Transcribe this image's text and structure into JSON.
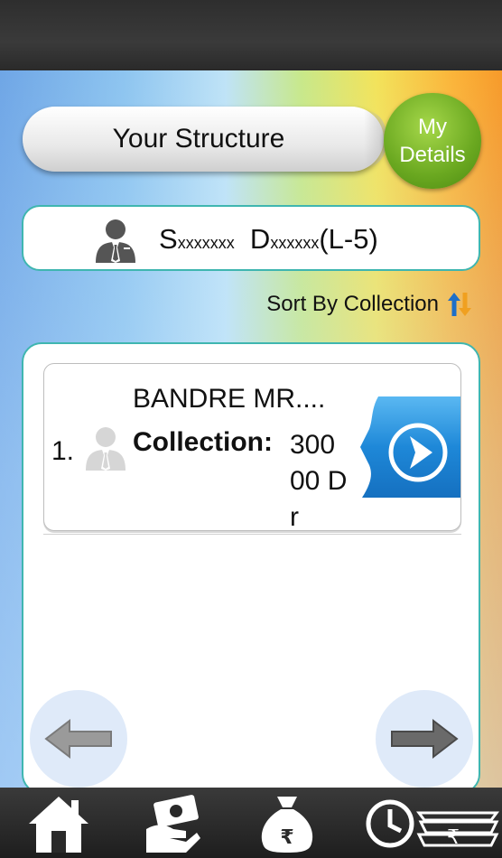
{
  "header": {
    "title": "Your Structure",
    "my_details_line1": "My",
    "my_details_line2": "Details"
  },
  "user": {
    "first_initial": "S",
    "first_rest": "xxxxxxx",
    "last_initial": "D",
    "last_rest": "xxxxxx",
    "level": "(L-5)"
  },
  "sort": {
    "label": "Sort By Collection"
  },
  "list": {
    "items": [
      {
        "index": "1.",
        "name": "BANDRE MR....",
        "collection_label": "Collection:",
        "collection_value": "30000 Dr"
      }
    ]
  },
  "colors": {
    "teal_border": "#3fb6b0",
    "green_button": "#6aa820",
    "blue_go": "#1e88d8",
    "top_bar": "#2e2e2e"
  },
  "icons": {
    "avatar": "user-tie-icon",
    "sort": "sort-arrows-icon",
    "go": "arrow-right-circle-icon",
    "prev": "arrow-left-icon",
    "next": "arrow-right-icon",
    "tabs": [
      "home-icon",
      "payment-hand-icon",
      "money-bag-rupee-icon",
      "history-rupee-icon"
    ]
  }
}
